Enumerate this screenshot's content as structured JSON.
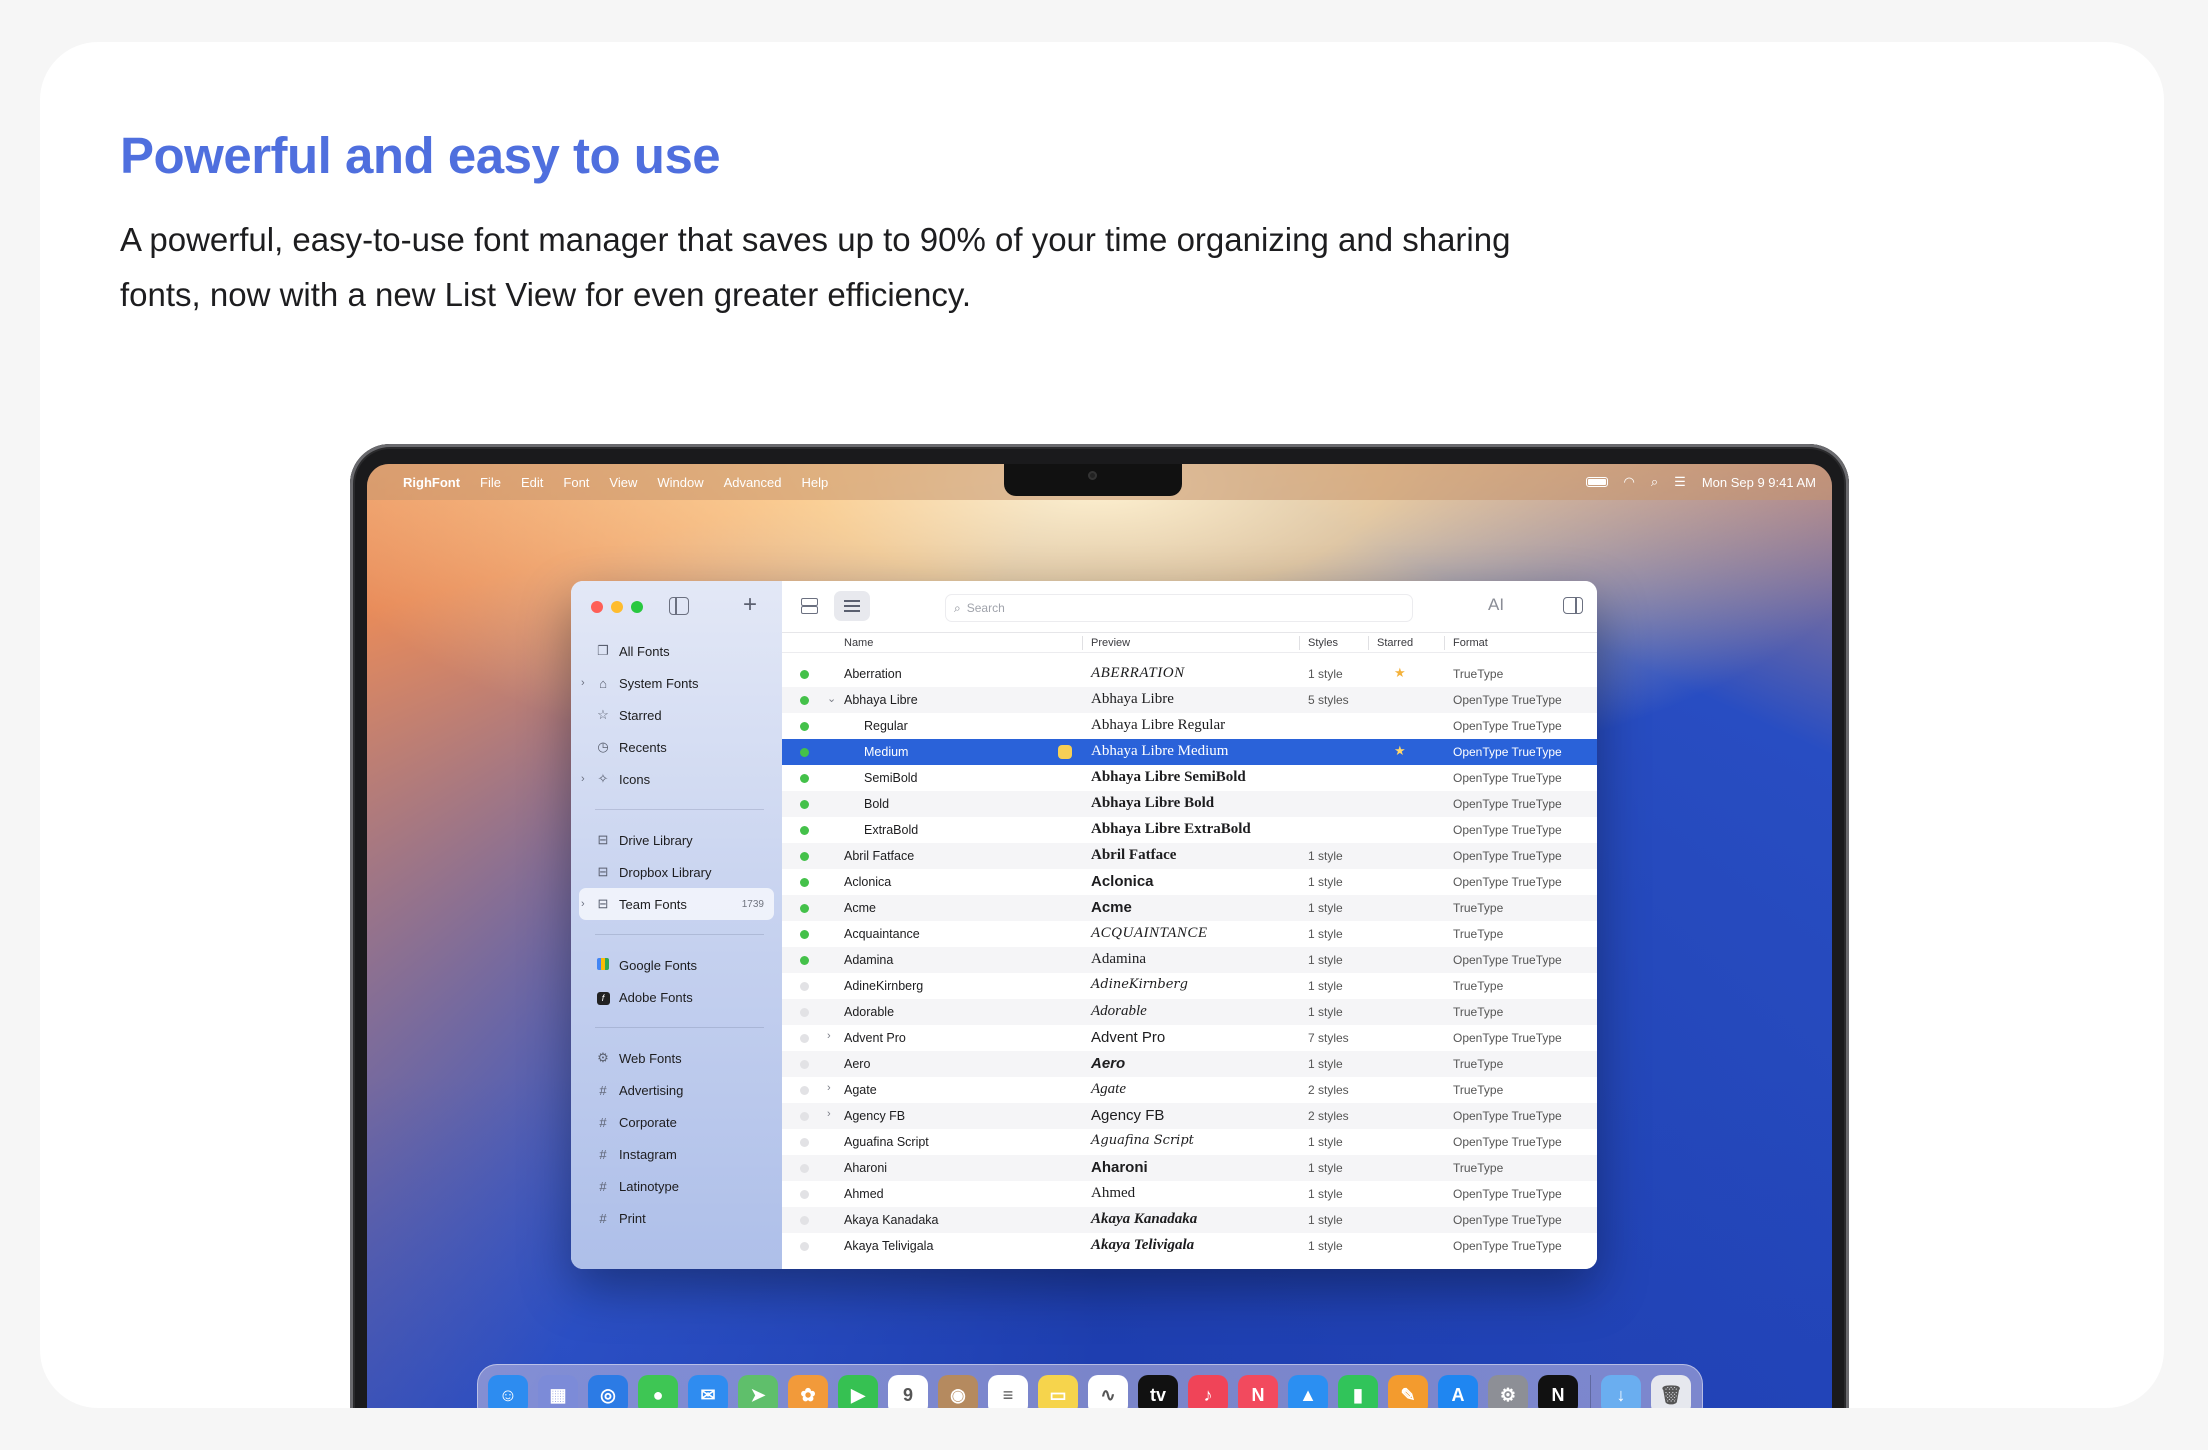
{
  "hero": {
    "title": "Powerful and easy to use",
    "subtitle": "A powerful, easy-to-use font manager that saves up to 90% of your time organizing and sharing fonts, now with a new List View for even greater efficiency."
  },
  "menubar": {
    "app_name": "RighFont",
    "items": [
      "File",
      "Edit",
      "Font",
      "View",
      "Window",
      "Advanced",
      "Help"
    ],
    "datetime": "Mon Sep 9  9:41 AM"
  },
  "sidebar": {
    "library_items": [
      {
        "label": "All Fonts",
        "icon": "copy-icon",
        "glyph": "❐"
      },
      {
        "label": "System Fonts",
        "icon": "lock-icon",
        "glyph": "⌂"
      },
      {
        "label": "Starred",
        "icon": "star-icon",
        "glyph": "☆"
      },
      {
        "label": "Recents",
        "icon": "clock-icon",
        "glyph": "◷"
      },
      {
        "label": "Icons",
        "icon": "sparkle-icon",
        "glyph": "✧"
      }
    ],
    "cloud_items": [
      {
        "label": "Drive Library",
        "icon": "drive-icon",
        "glyph": "⊟"
      },
      {
        "label": "Dropbox Library",
        "icon": "drive-icon",
        "glyph": "⊟"
      },
      {
        "label": "Team Fonts",
        "icon": "drive-icon",
        "glyph": "⊟",
        "count": "1739"
      }
    ],
    "provider_items": [
      {
        "label": "Google Fonts",
        "icon": "google-fonts-icon"
      },
      {
        "label": "Adobe Fonts",
        "icon": "adobe-fonts-icon"
      }
    ],
    "collection_items": [
      {
        "label": "Web Fonts",
        "icon": "gear-icon",
        "glyph": "⚙"
      },
      {
        "label": "Advertising",
        "icon": "hashtag-icon",
        "glyph": "#"
      },
      {
        "label": "Corporate",
        "icon": "hashtag-icon",
        "glyph": "#"
      },
      {
        "label": "Instagram",
        "icon": "hashtag-icon",
        "glyph": "#"
      },
      {
        "label": "Latinotype",
        "icon": "hashtag-icon",
        "glyph": "#"
      },
      {
        "label": "Print",
        "icon": "hashtag-icon",
        "glyph": "#"
      }
    ]
  },
  "toolbar": {
    "search_placeholder": "Search"
  },
  "table": {
    "columns": {
      "name": "Name",
      "preview": "Preview",
      "styles": "Styles",
      "starred": "Starred",
      "format": "Format"
    },
    "rows": [
      {
        "active": true,
        "expand": "",
        "name": "Aberration",
        "preview": "ABERRATION",
        "pclass": "p-caps",
        "styles": "1 style",
        "starred": true,
        "format": "TrueType"
      },
      {
        "active": true,
        "expand": "⌄",
        "name": "Abhaya Libre",
        "preview": "Abhaya Libre",
        "pclass": "",
        "styles": "5 styles",
        "starred": false,
        "format": "OpenType TrueType"
      },
      {
        "active": true,
        "expand": "",
        "name": "Regular",
        "child": true,
        "preview": "Abhaya Libre Regular",
        "pclass": "",
        "styles": "",
        "starred": false,
        "format": "OpenType TrueType"
      },
      {
        "active": true,
        "expand": "",
        "name": "Medium",
        "child": true,
        "selected": true,
        "preview": "Abhaya Libre Medium",
        "pclass": "",
        "styles": "",
        "starred": true,
        "format": "OpenType TrueType"
      },
      {
        "active": true,
        "expand": "",
        "name": "SemiBold",
        "child": true,
        "preview": "Abhaya Libre SemiBold",
        "pclass": "p-bold",
        "styles": "",
        "starred": false,
        "format": "OpenType TrueType"
      },
      {
        "active": true,
        "expand": "",
        "name": "Bold",
        "child": true,
        "preview": "Abhaya Libre Bold",
        "pclass": "p-bold",
        "styles": "",
        "starred": false,
        "format": "OpenType TrueType"
      },
      {
        "active": true,
        "expand": "",
        "name": "ExtraBold",
        "child": true,
        "preview": "Abhaya Libre ExtraBold",
        "pclass": "p-bold",
        "styles": "",
        "starred": false,
        "format": "OpenType TrueType"
      },
      {
        "active": true,
        "expand": "",
        "name": "Abril Fatface",
        "preview": "Abril Fatface",
        "pclass": "p-bold",
        "styles": "1 style",
        "starred": false,
        "format": "OpenType TrueType"
      },
      {
        "active": true,
        "expand": "",
        "name": "Aclonica",
        "preview": "Aclonica",
        "pclass": "p-sans p-bold",
        "styles": "1 style",
        "starred": false,
        "format": "OpenType TrueType"
      },
      {
        "active": true,
        "expand": "",
        "name": "Acme",
        "preview": "Acme",
        "pclass": "p-sans p-bold",
        "styles": "1 style",
        "starred": false,
        "format": "TrueType"
      },
      {
        "active": true,
        "expand": "",
        "name": "Acquaintance",
        "preview": "ACQUAINTANCE",
        "pclass": "p-caps",
        "styles": "1 style",
        "starred": false,
        "format": "TrueType"
      },
      {
        "active": true,
        "expand": "",
        "name": "Adamina",
        "preview": "Adamina",
        "pclass": "",
        "styles": "1 style",
        "starred": false,
        "format": "OpenType TrueType"
      },
      {
        "active": false,
        "expand": "",
        "name": "AdineKirnberg",
        "preview": "AdineKirnberg",
        "pclass": "p-script",
        "styles": "1 style",
        "starred": false,
        "format": "TrueType"
      },
      {
        "active": false,
        "expand": "",
        "name": "Adorable",
        "preview": "Adorable",
        "pclass": "p-italic",
        "styles": "1 style",
        "starred": false,
        "format": "TrueType"
      },
      {
        "active": false,
        "expand": "›",
        "name": "Advent Pro",
        "preview": "Advent Pro",
        "pclass": "p-sans",
        "styles": "7 styles",
        "starred": false,
        "format": "OpenType TrueType"
      },
      {
        "active": false,
        "expand": "",
        "name": "Aero",
        "preview": "Aero",
        "pclass": "p-sans p-bold p-italic",
        "styles": "1 style",
        "starred": false,
        "format": "TrueType"
      },
      {
        "active": false,
        "expand": "›",
        "name": "Agate",
        "preview": "Agate",
        "pclass": "p-italic",
        "styles": "2 styles",
        "starred": false,
        "format": "TrueType"
      },
      {
        "active": false,
        "expand": "›",
        "name": "Agency FB",
        "preview": "Agency FB",
        "pclass": "p-sans",
        "styles": "2 styles",
        "starred": false,
        "format": "OpenType TrueType"
      },
      {
        "active": false,
        "expand": "",
        "name": "Aguafina Script",
        "preview": "Aguafina Script",
        "pclass": "p-script",
        "styles": "1 style",
        "starred": false,
        "format": "OpenType TrueType"
      },
      {
        "active": false,
        "expand": "",
        "name": "Aharoni",
        "preview": "Aharoni",
        "pclass": "p-sans p-bold",
        "styles": "1 style",
        "starred": false,
        "format": "TrueType"
      },
      {
        "active": false,
        "expand": "",
        "name": "Ahmed",
        "preview": "Ahmed",
        "pclass": "",
        "styles": "1 style",
        "starred": false,
        "format": "OpenType TrueType"
      },
      {
        "active": false,
        "expand": "",
        "name": "Akaya Kanadaka",
        "preview": "Akaya Kanadaka",
        "pclass": "p-bold p-italic",
        "styles": "1 style",
        "starred": false,
        "format": "OpenType TrueType"
      },
      {
        "active": false,
        "expand": "",
        "name": "Akaya Telivigala",
        "preview": "Akaya Telivigala",
        "pclass": "p-bold p-italic",
        "styles": "1 style",
        "starred": false,
        "format": "OpenType TrueType"
      }
    ]
  },
  "dock": {
    "apps": [
      {
        "icon": "finder-icon",
        "color": "#2d8cf0",
        "glyph": "☺",
        "running": true
      },
      {
        "icon": "launchpad-icon",
        "color": "#7c8bd8",
        "glyph": "▦"
      },
      {
        "icon": "safari-icon",
        "color": "#2c7be5",
        "glyph": "◎"
      },
      {
        "icon": "messages-icon",
        "color": "#3ec654",
        "glyph": "●"
      },
      {
        "icon": "mail-icon",
        "color": "#2f8cf0",
        "glyph": "✉"
      },
      {
        "icon": "maps-icon",
        "color": "#5fbf6b",
        "glyph": "➤"
      },
      {
        "icon": "photos-icon",
        "color": "#f29a3a",
        "glyph": "✿"
      },
      {
        "icon": "facetime-icon",
        "color": "#36c152",
        "glyph": "▶"
      },
      {
        "icon": "calendar-icon",
        "color": "#ffffff",
        "glyph": "9"
      },
      {
        "icon": "contacts-icon",
        "color": "#b58a5f",
        "glyph": "◉"
      },
      {
        "icon": "reminders-icon",
        "color": "#ffffff",
        "glyph": "≡"
      },
      {
        "icon": "notes-icon",
        "color": "#f6d44c",
        "glyph": "▭"
      },
      {
        "icon": "freeform-icon",
        "color": "#ffffff",
        "glyph": "∿"
      },
      {
        "icon": "apple-tv-icon",
        "color": "#111111",
        "glyph": "tv"
      },
      {
        "icon": "music-icon",
        "color": "#f04458",
        "glyph": "♪"
      },
      {
        "icon": "news-icon",
        "color": "#f24a5e",
        "glyph": "N"
      },
      {
        "icon": "keynote-icon",
        "color": "#2b8ff2",
        "glyph": "▲"
      },
      {
        "icon": "numbers-icon",
        "color": "#31c45a",
        "glyph": "▮"
      },
      {
        "icon": "pages-icon",
        "color": "#f39b2e",
        "glyph": "✎"
      },
      {
        "icon": "app-store-icon",
        "color": "#1f86f1",
        "glyph": "A"
      },
      {
        "icon": "system-settings-icon",
        "color": "#8d8f96",
        "glyph": "⚙"
      },
      {
        "icon": "righfont-icon",
        "color": "#111111",
        "glyph": "N",
        "running": true
      }
    ],
    "trailing": [
      {
        "icon": "downloads-folder-icon",
        "color": "#6aaef0",
        "glyph": "↓"
      },
      {
        "icon": "trash-icon",
        "color": "#e6e8ee",
        "glyph": "🗑"
      }
    ]
  }
}
